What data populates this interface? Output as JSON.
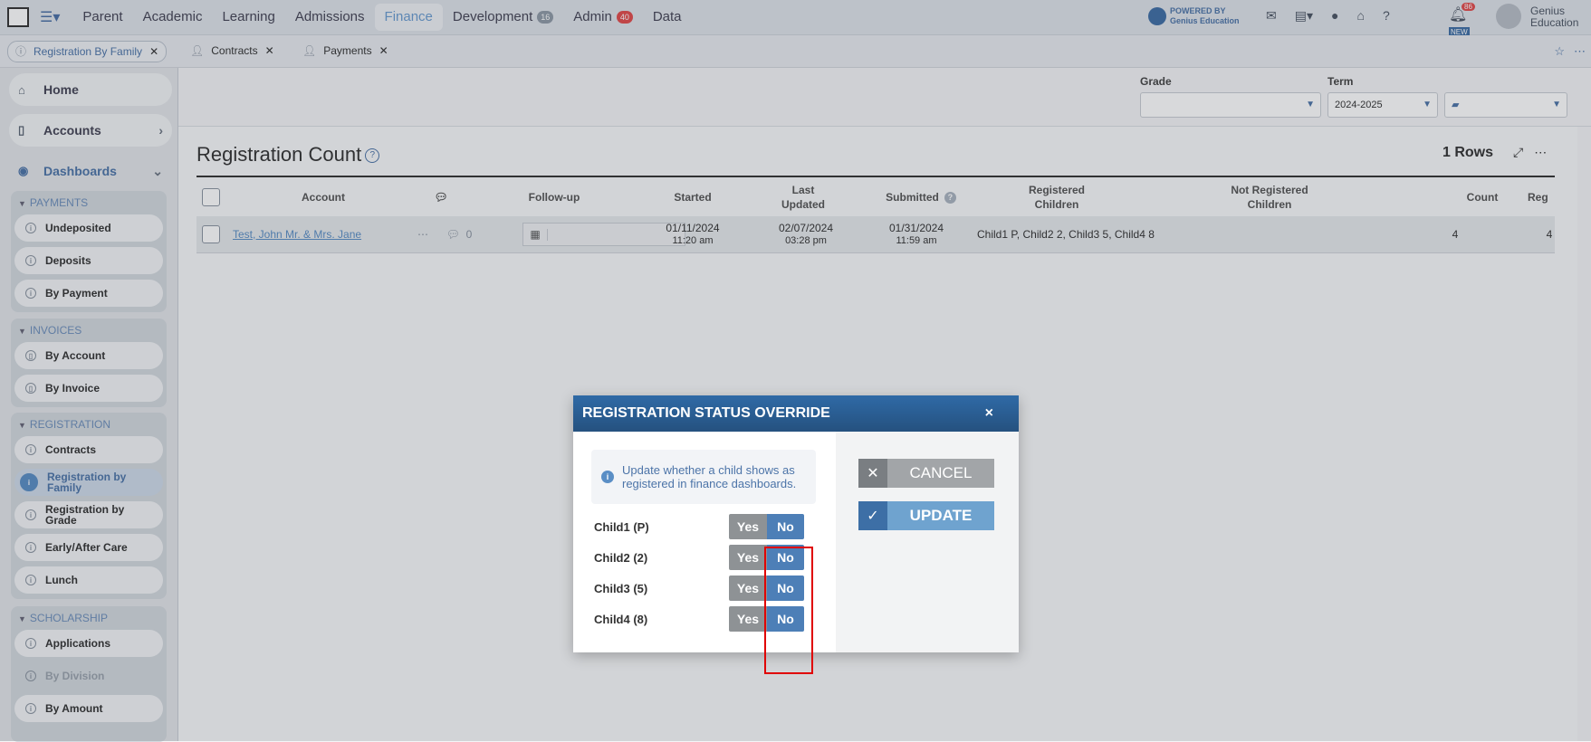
{
  "nav": {
    "items": [
      {
        "label": "Parent",
        "active": false,
        "badge": ""
      },
      {
        "label": "Academic",
        "active": false,
        "badge": ""
      },
      {
        "label": "Learning",
        "active": false,
        "badge": ""
      },
      {
        "label": "Admissions",
        "active": false,
        "badge": ""
      },
      {
        "label": "Finance",
        "active": true,
        "badge": ""
      },
      {
        "label": "Development",
        "active": false,
        "badge": "16"
      },
      {
        "label": "Admin",
        "active": false,
        "badge": "40"
      },
      {
        "label": "Data",
        "active": false,
        "badge": ""
      }
    ],
    "powered_line1": "POWERED BY",
    "powered_line2": "Genius Education",
    "notifications_count": "86",
    "new_label": "NEW",
    "user_line1": "Genius",
    "user_line2": "Education"
  },
  "tabs": [
    {
      "label": "Registration By Family",
      "active": true
    },
    {
      "label": "Contracts",
      "active": false
    },
    {
      "label": "Payments",
      "active": false
    }
  ],
  "sidebar": {
    "home": "Home",
    "accounts": "Accounts",
    "dashboards": "Dashboards",
    "groups": {
      "payments": {
        "title": "PAYMENTS",
        "items": [
          "Undeposited",
          "Deposits",
          "By Payment"
        ]
      },
      "invoices": {
        "title": "INVOICES",
        "items": [
          "By Account",
          "By Invoice"
        ]
      },
      "registration": {
        "title": "REGISTRATION",
        "items": [
          "Contracts",
          "Registration by Family",
          "Registration by Grade",
          "Early/After Care",
          "Lunch"
        ]
      },
      "scholarship": {
        "title": "SCHOLARSHIP",
        "items": [
          "Applications",
          "By Division",
          "By Amount"
        ]
      }
    }
  },
  "filters": {
    "grade_label": "Grade",
    "grade_value": "",
    "term_label": "Term",
    "term_value": "2024-2025",
    "folder_value": ""
  },
  "report": {
    "title": "Registration Count",
    "rows": "1 Rows",
    "columns": {
      "account": "Account",
      "followup": "Follow-up",
      "started": "Started",
      "last_updated_1": "Last",
      "last_updated_2": "Updated",
      "submitted": "Submitted",
      "registered_1": "Registered",
      "registered_2": "Children",
      "not_registered_1": "Not Registered",
      "not_registered_2": "Children",
      "count": "Count",
      "reg": "Reg"
    },
    "row": {
      "account": "Test, John Mr. & Mrs. Jane",
      "comments": "0",
      "started_date": "01/11/2024",
      "started_time": "11:20 am",
      "updated_date": "02/07/2024",
      "updated_time": "03:28 pm",
      "submitted_date": "01/31/2024",
      "submitted_time": "11:59 am",
      "registered": "Child1 P, Child2 2, Child3 5, Child4 8",
      "not_registered": "",
      "count": "4",
      "reg": "4"
    }
  },
  "modal": {
    "title": "REGISTRATION STATUS OVERRIDE",
    "close": "×",
    "info": "Update whether a child shows as registered in finance dashboards.",
    "children": [
      {
        "label": "Child1 (P)",
        "yes": "Yes",
        "no": "No"
      },
      {
        "label": "Child2 (2)",
        "yes": "Yes",
        "no": "No"
      },
      {
        "label": "Child3 (5)",
        "yes": "Yes",
        "no": "No"
      },
      {
        "label": "Child4 (8)",
        "yes": "Yes",
        "no": "No"
      }
    ],
    "cancel": "CANCEL",
    "update": "UPDATE"
  },
  "colors": {
    "accent": "#4c74a8",
    "modal_header": "#2f6aa6",
    "no_selected": "#4d7fb7",
    "highlight": "#e00000"
  }
}
